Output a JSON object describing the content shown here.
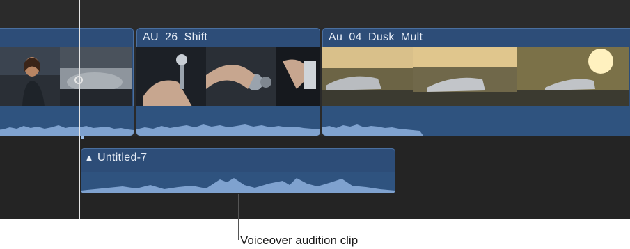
{
  "timeline": {
    "clips": [
      {
        "id": "clip-1",
        "title": ""
      },
      {
        "id": "clip-2",
        "title": "AU_26_Shift"
      },
      {
        "id": "clip-3",
        "title": "Au_04_Dusk_Mult"
      }
    ],
    "connected_clip": {
      "title": "Untitled-7",
      "icon": "audition-icon"
    },
    "colors": {
      "clip_blue": "#2d4d78",
      "clip_border": "#4a6f9f",
      "waveform": "#7fa2cf",
      "timeline_bg": "#2a2a2a"
    }
  },
  "callout": {
    "text": "Voiceover audition clip"
  }
}
